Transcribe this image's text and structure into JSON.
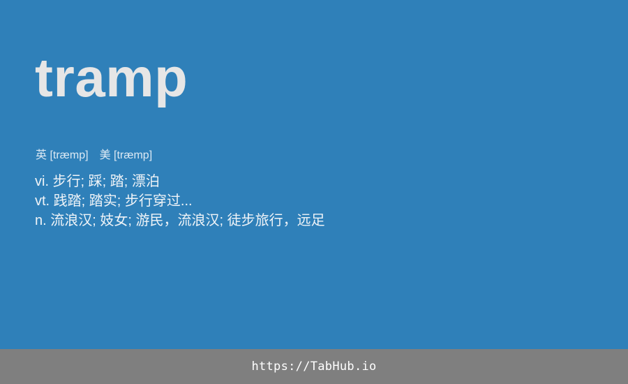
{
  "entry": {
    "word": "tramp",
    "phonetics": {
      "uk": "英 [træmp]",
      "us": "美 [træmp]"
    },
    "definitions": [
      "vi. 步行; 踩; 踏; 漂泊",
      "vt. 践踏; 踏实; 步行穿过...",
      "n. 流浪汉; 妓女; 游民，流浪汉; 徒步旅行，远足"
    ]
  },
  "footer": {
    "url": "https://TabHub.io"
  },
  "colors": {
    "background": "#2f80b9",
    "word": "#e6e6e6",
    "footer": "#7f7f7f",
    "footer_text": "#ffffff"
  }
}
